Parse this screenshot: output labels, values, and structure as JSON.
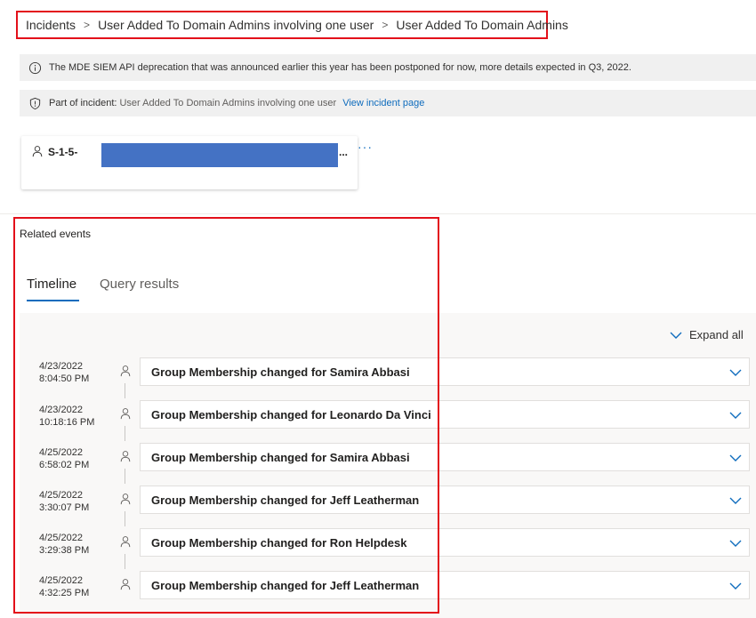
{
  "breadcrumb": [
    {
      "label": "Incidents"
    },
    {
      "label": "User Added To Domain Admins involving one user"
    },
    {
      "label": "User Added To Domain Admins"
    }
  ],
  "banners": {
    "deprecation": "The MDE SIEM API deprecation that was announced earlier this year has been postponed for now, more details expected in Q3, 2022.",
    "incident_label": "Part of incident:",
    "incident_name": "User Added To Domain Admins involving one user",
    "incident_link": "View incident page"
  },
  "entity": {
    "name_prefix": "S-1-5-",
    "ellipsis": "...",
    "more": "···"
  },
  "related": {
    "title": "Related events",
    "tabs": [
      {
        "label": "Timeline",
        "selected": true
      },
      {
        "label": "Query results",
        "selected": false
      }
    ],
    "expand_all": "Expand all",
    "events": [
      {
        "date": "4/23/2022",
        "time": "8:04:50 PM",
        "title": "Group Membership changed for Samira Abbasi"
      },
      {
        "date": "4/23/2022",
        "time": "10:18:16 PM",
        "title": "Group Membership changed for Leonardo Da Vinci"
      },
      {
        "date": "4/25/2022",
        "time": "6:58:02 PM",
        "title": "Group Membership changed for Samira Abbasi"
      },
      {
        "date": "4/25/2022",
        "time": "3:30:07 PM",
        "title": "Group Membership changed for Jeff Leatherman"
      },
      {
        "date": "4/25/2022",
        "time": "3:29:38 PM",
        "title": "Group Membership changed for Ron Helpdesk"
      },
      {
        "date": "4/25/2022",
        "time": "4:32:25 PM",
        "title": "Group Membership changed for Jeff Leatherman"
      }
    ]
  },
  "colors": {
    "accent": "#0f6cbd",
    "highlight": "#e3101a",
    "redaction": "#4472c4"
  }
}
